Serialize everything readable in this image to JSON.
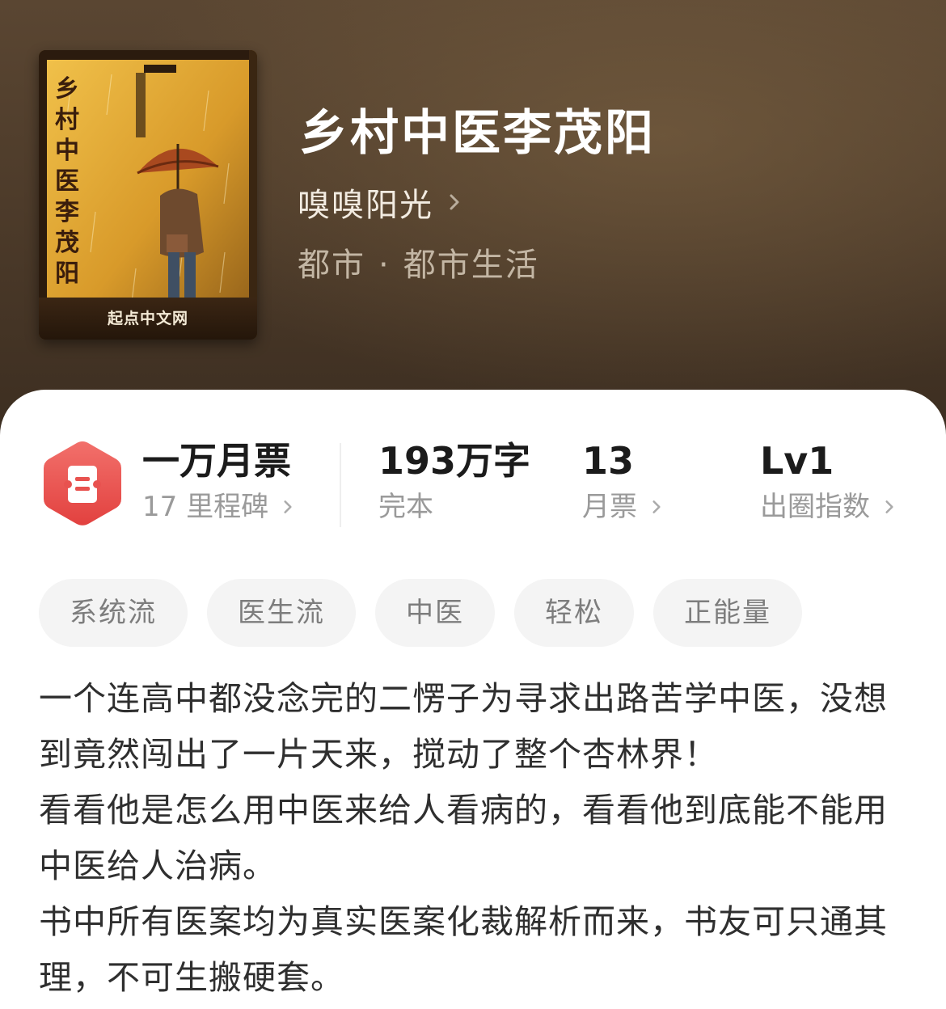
{
  "colors": {
    "header_bg": "#4d3b2a",
    "accent_red": "#e8524f",
    "tag_bg": "#f4f4f4"
  },
  "cover": {
    "title_vertical": "乡村中医李茂阳",
    "brand": "起点中文网"
  },
  "book": {
    "title": "乡村中医李茂阳",
    "author": "嗅嗅阳光",
    "genre": "都市",
    "genre_separator": "·",
    "subgenre": "都市生活"
  },
  "stats": {
    "milestone": {
      "value": "一万月票",
      "label": "17 里程碑",
      "icon": "ticket-icon"
    },
    "words": {
      "value": "193万字",
      "label": "完本"
    },
    "monthly_votes": {
      "value": "13",
      "label": "月票"
    },
    "influence": {
      "value": "Lv1",
      "label": "出圈指数"
    }
  },
  "tags": [
    "系统流",
    "医生流",
    "中医",
    "轻松",
    "正能量"
  ],
  "description": [
    "一个连高中都没念完的二愣子为寻求出路苦学中医，没想到竟然闯出了一片天来，搅动了整个杏林界！",
    "看看他是怎么用中医来给人看病的，看看他到底能不能用中医给人治病。",
    "书中所有医案均为真实医案化裁解析而来，书友可只通其理，不可生搬硬套。"
  ]
}
